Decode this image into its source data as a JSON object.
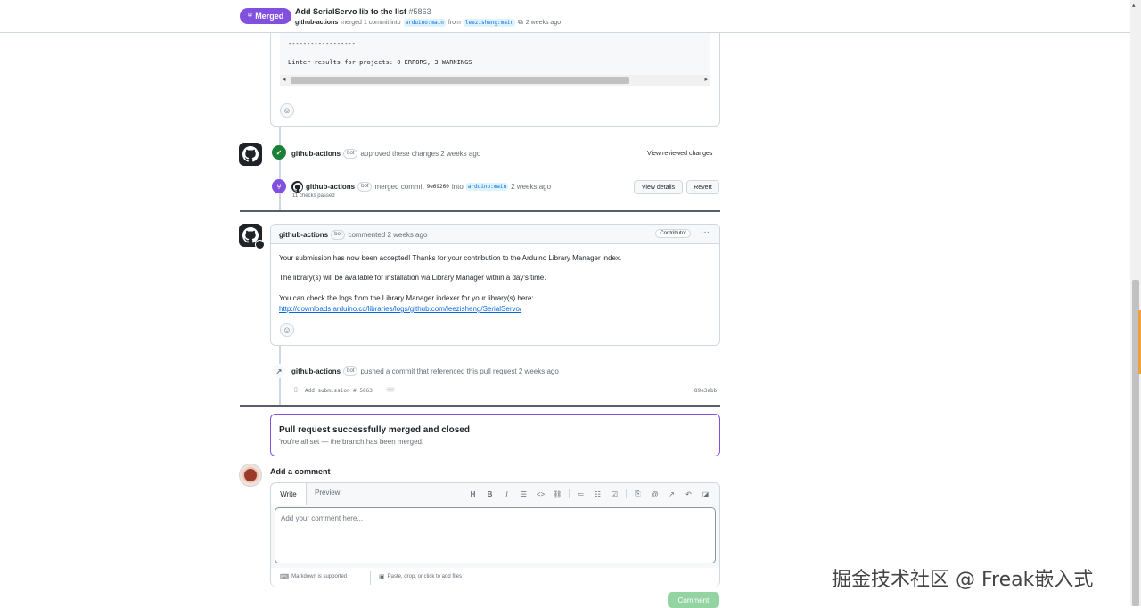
{
  "header": {
    "state_label": "Merged",
    "pr_title": "Add SerialServo lib to the list",
    "pr_number": "#5863",
    "merger": "github-actions",
    "merged_text": "merged 1 commit into",
    "base_branch": "arduino:main",
    "from_text": "from",
    "head_branch": "leezisheng:main",
    "time": "2 weeks ago"
  },
  "code_block": {
    "line1": "------------------",
    "line2": "Linter results for projects: 0 ERRORS, 3 WARNINGS"
  },
  "approval": {
    "author": "github-actions",
    "bot_label": "bot",
    "text": "approved these changes 2 weeks ago",
    "view_reviewed": "View reviewed changes"
  },
  "merge_event": {
    "author": "github-actions",
    "bot_label": "bot",
    "text": "merged commit",
    "commit": "9e69260",
    "into": "into",
    "branch": "arduino:main",
    "time": "2 weeks ago",
    "checks": "11 checks passed",
    "view_details": "View details",
    "revert": "Revert"
  },
  "comment": {
    "author": "github-actions",
    "bot_label": "bot",
    "meta": "commented 2 weeks ago",
    "role": "Contributor",
    "more": "···",
    "p1": "Your submission has now been accepted! Thanks for your contribution to the Arduino Library Manager index.",
    "p2": "The library(s) will be available for installation via Library Manager within a day's time.",
    "p3": "You can check the logs from the Library Manager indexer for your library(s) here:",
    "link": "http://downloads.arduino.cc/libraries/logs/github.com/leezisheng/SerialServo/"
  },
  "push_event": {
    "author": "github-actions",
    "bot_label": "bot",
    "text": "pushed a commit that referenced this pull request 2 weeks ago",
    "commit_msg": "Add submission # 5863",
    "ellipsis": "···",
    "sha": "89e3abb"
  },
  "merged_box": {
    "title": "Pull request successfully merged and closed",
    "subtitle": "You're all set — the branch has been merged."
  },
  "add_comment": {
    "title": "Add a comment",
    "tab_write": "Write",
    "tab_preview": "Preview",
    "placeholder": "Add your comment here...",
    "markdown_note": "Markdown is supported",
    "attach_note": "Paste, drop, or click to add files",
    "submit": "Comment"
  },
  "toolbar_icons": [
    "heading-icon",
    "bold-icon",
    "italic-icon",
    "quote-icon",
    "code-icon",
    "link-icon",
    "ordered-list-icon",
    "unordered-list-icon",
    "task-list-icon",
    "attach-icon",
    "mention-icon",
    "reference-icon",
    "undo-icon",
    "slash-icon"
  ],
  "watermark": "掘金技术社区 @ Freak嵌入式",
  "colors": {
    "merged": "#8250df",
    "approved": "#1a7f37",
    "link": "#0969da"
  }
}
